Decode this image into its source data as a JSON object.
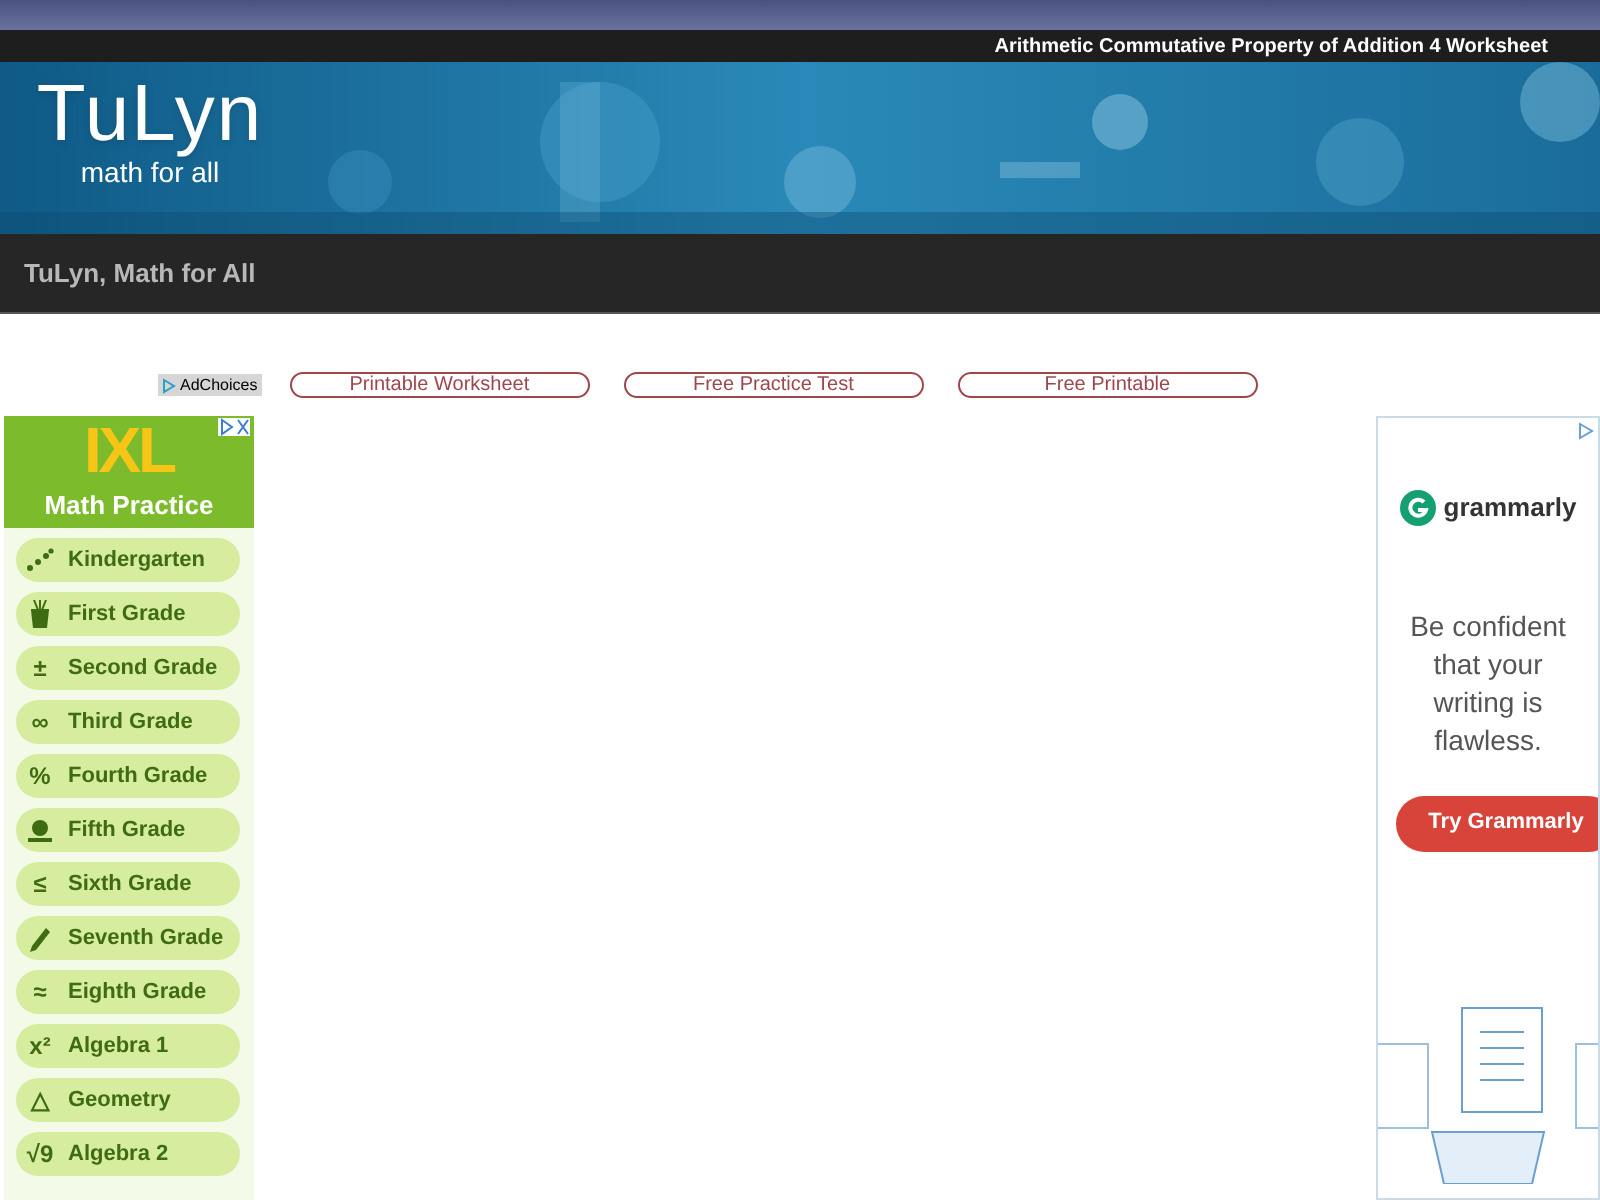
{
  "header": {
    "page_title": "Arithmetic Commutative Property of Addition 4 Worksheet",
    "logo": "TuLyn",
    "tagline": "math for all",
    "site_name": "TuLyn, Math for All"
  },
  "ad_bar": {
    "adchoices": "AdChoices",
    "links": [
      "Printable Worksheet",
      "Free Practice Test",
      "Free Printable"
    ]
  },
  "left_ad": {
    "brand": "IXL",
    "title": "Math Practice",
    "items": [
      {
        "kind": "drawing",
        "label": "Kindergarten"
      },
      {
        "kind": "drawing",
        "label": "First Grade"
      },
      {
        "kind": "glyph",
        "symbol": "±",
        "label": "Second Grade"
      },
      {
        "kind": "glyph",
        "symbol": "∞",
        "label": "Third Grade"
      },
      {
        "kind": "glyph",
        "symbol": "%",
        "label": "Fourth Grade"
      },
      {
        "kind": "drawing",
        "label": "Fifth Grade"
      },
      {
        "kind": "glyph",
        "symbol": "≤",
        "label": "Sixth Grade"
      },
      {
        "kind": "drawing",
        "label": "Seventh Grade"
      },
      {
        "kind": "glyph",
        "symbol": "≈",
        "label": "Eighth Grade"
      },
      {
        "kind": "glyph",
        "symbol": "x²",
        "label": "Algebra 1"
      },
      {
        "kind": "glyph",
        "symbol": "△",
        "label": "Geometry"
      },
      {
        "kind": "glyph",
        "symbol": "√9",
        "label": "Algebra 2"
      }
    ]
  },
  "right_ad": {
    "brand": "grammarly",
    "message": "Be confident that your writing is flawless.",
    "button": "Try Grammarly"
  }
}
